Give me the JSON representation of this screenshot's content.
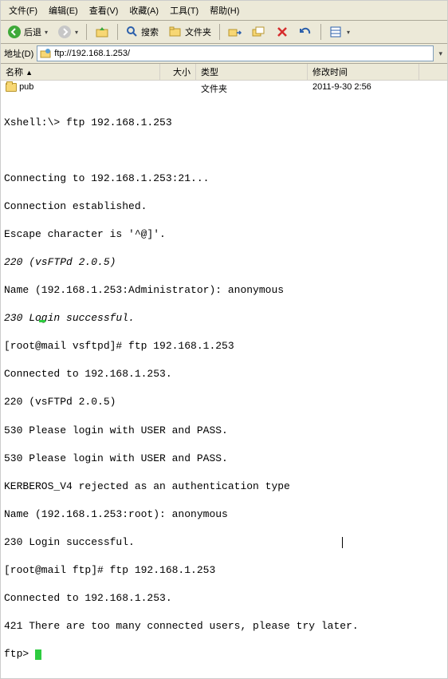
{
  "menu": {
    "file": "文件(F)",
    "edit": "编辑(E)",
    "view": "查看(V)",
    "favorites": "收藏(A)",
    "tools": "工具(T)",
    "help": "帮助(H)"
  },
  "toolbar": {
    "back": "后退",
    "search": "搜索",
    "folders": "文件夹"
  },
  "addressbar": {
    "label": "地址(D)",
    "url": "ftp://192.168.1.253/"
  },
  "columns": {
    "name": "名称",
    "size": "大小",
    "type": "类型",
    "modified": "修改时间"
  },
  "rows": [
    {
      "name": "pub",
      "size": "",
      "type": "文件夹",
      "modified": "2011-9-30 2:56"
    }
  ],
  "terminal": {
    "l01": "Xshell:\\> ftp 192.168.1.253",
    "l02": "",
    "l03": "",
    "l04": "Connecting to 192.168.1.253:21...",
    "l05": "Connection established.",
    "l06": "Escape character is '^@]'.",
    "l07": "220 (vsFTPd 2.0.5)",
    "l08": "Name (192.168.1.253:Administrator): anonymous",
    "l09": "230 Login successful.",
    "l10": "[root@mail vsftpd]# ftp 192.168.1.253",
    "l11": "Connected to 192.168.1.253.",
    "l12": "220 (vsFTPd 2.0.5)",
    "l13": "530 Please login with USER and PASS.",
    "l14": "530 Please login with USER and PASS.",
    "l15": "KERBEROS_V4 rejected as an authentication type",
    "l16": "Name (192.168.1.253:root): anonymous",
    "l17": "230 Login successful.",
    "l18": "[root@mail ftp]# ftp 192.168.1.253",
    "l19": "Connected to 192.168.1.253.",
    "l20": "421 There are too many connected users, please try later.",
    "l21": "ftp> "
  }
}
